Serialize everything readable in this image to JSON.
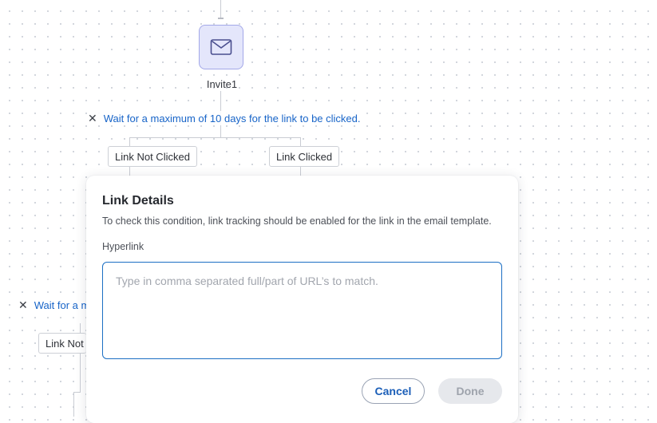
{
  "flow": {
    "email_node": {
      "icon": "envelope-icon",
      "label": "Invite1"
    },
    "wait_condition": {
      "text": "Wait for a maximum of 10 days for the link to be clicked."
    },
    "branches": [
      "Link Not Clicked",
      "Link Clicked"
    ],
    "partial_wait_text": "Wait for a m",
    "partial_branch_text": "Link Not C"
  },
  "modal": {
    "title": "Link Details",
    "description": "To check this condition, link tracking should be enabled for the link in the email template.",
    "field_label": "Hyperlink",
    "placeholder": "Type in comma separated full/part of URL’s to match.",
    "value": "",
    "cancel_label": "Cancel",
    "done_label": "Done"
  },
  "colors": {
    "accent": "#1764c8",
    "node_fill": "#e4e6fb",
    "node_border": "#a3a8e8",
    "disabled_button": "#e6e8ec"
  }
}
